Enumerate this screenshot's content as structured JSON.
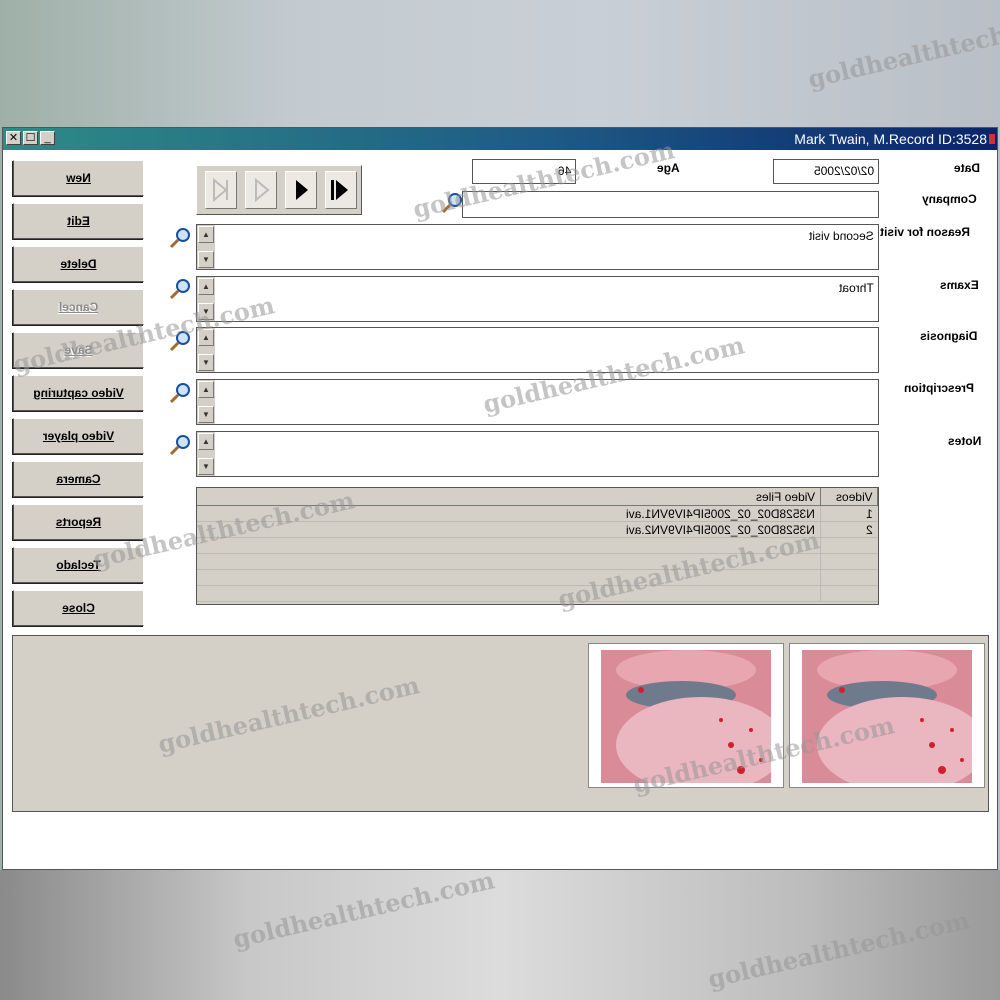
{
  "window": {
    "title": "Mark Twain, M.Record ID:3528",
    "controls": {
      "close": "✕",
      "maximize": "☐",
      "minimize": "_"
    }
  },
  "sidebar": {
    "buttons": [
      {
        "label": "New",
        "enabled": true
      },
      {
        "label": "Edit",
        "enabled": true
      },
      {
        "label": "Delete",
        "enabled": true
      },
      {
        "label": "Cancel",
        "enabled": false
      },
      {
        "label": "Save",
        "enabled": false
      },
      {
        "label": "Video capturing",
        "enabled": true
      },
      {
        "label": "Video player",
        "enabled": true
      },
      {
        "label": "Camera",
        "enabled": true
      },
      {
        "label": "Reports",
        "enabled": true
      },
      {
        "label": "Teclado",
        "enabled": true
      },
      {
        "label": "Close",
        "enabled": true
      }
    ]
  },
  "navigator": {
    "icons": [
      "first-record-icon",
      "previous-record-icon",
      "next-record-icon",
      "last-record-icon"
    ]
  },
  "form": {
    "date_label": "Date",
    "date_value": "02/02/2005",
    "age_label": "Age",
    "age_value": "46",
    "company_label": "Company",
    "company_value": "",
    "reason_label": "Reason for visit",
    "reason_value": "Second visit",
    "exams_label": "Exams",
    "exams_value": "Throat",
    "diagnosis_label": "Diagnosis",
    "diagnosis_value": "",
    "prescription_label": "Prescription",
    "prescription_value": "",
    "notes_label": "Notes",
    "notes_value": ""
  },
  "videos_table": {
    "headers": [
      "Videos",
      "Video Files"
    ],
    "rows": [
      [
        "1",
        "N3528D02_02_2005IP4IV9VN1.avi"
      ],
      [
        "2",
        "N3528D02_02_2005IP4IV9VN2.avi"
      ]
    ]
  },
  "thumbnails": [
    {
      "name": "throat-image-1"
    },
    {
      "name": "throat-image-2"
    }
  ],
  "watermark": "goldhealthtech.com",
  "colors": {
    "title_gradient_start": "#2e8b86",
    "title_gradient_end": "#0a246a",
    "face": "#d4d0c8"
  }
}
